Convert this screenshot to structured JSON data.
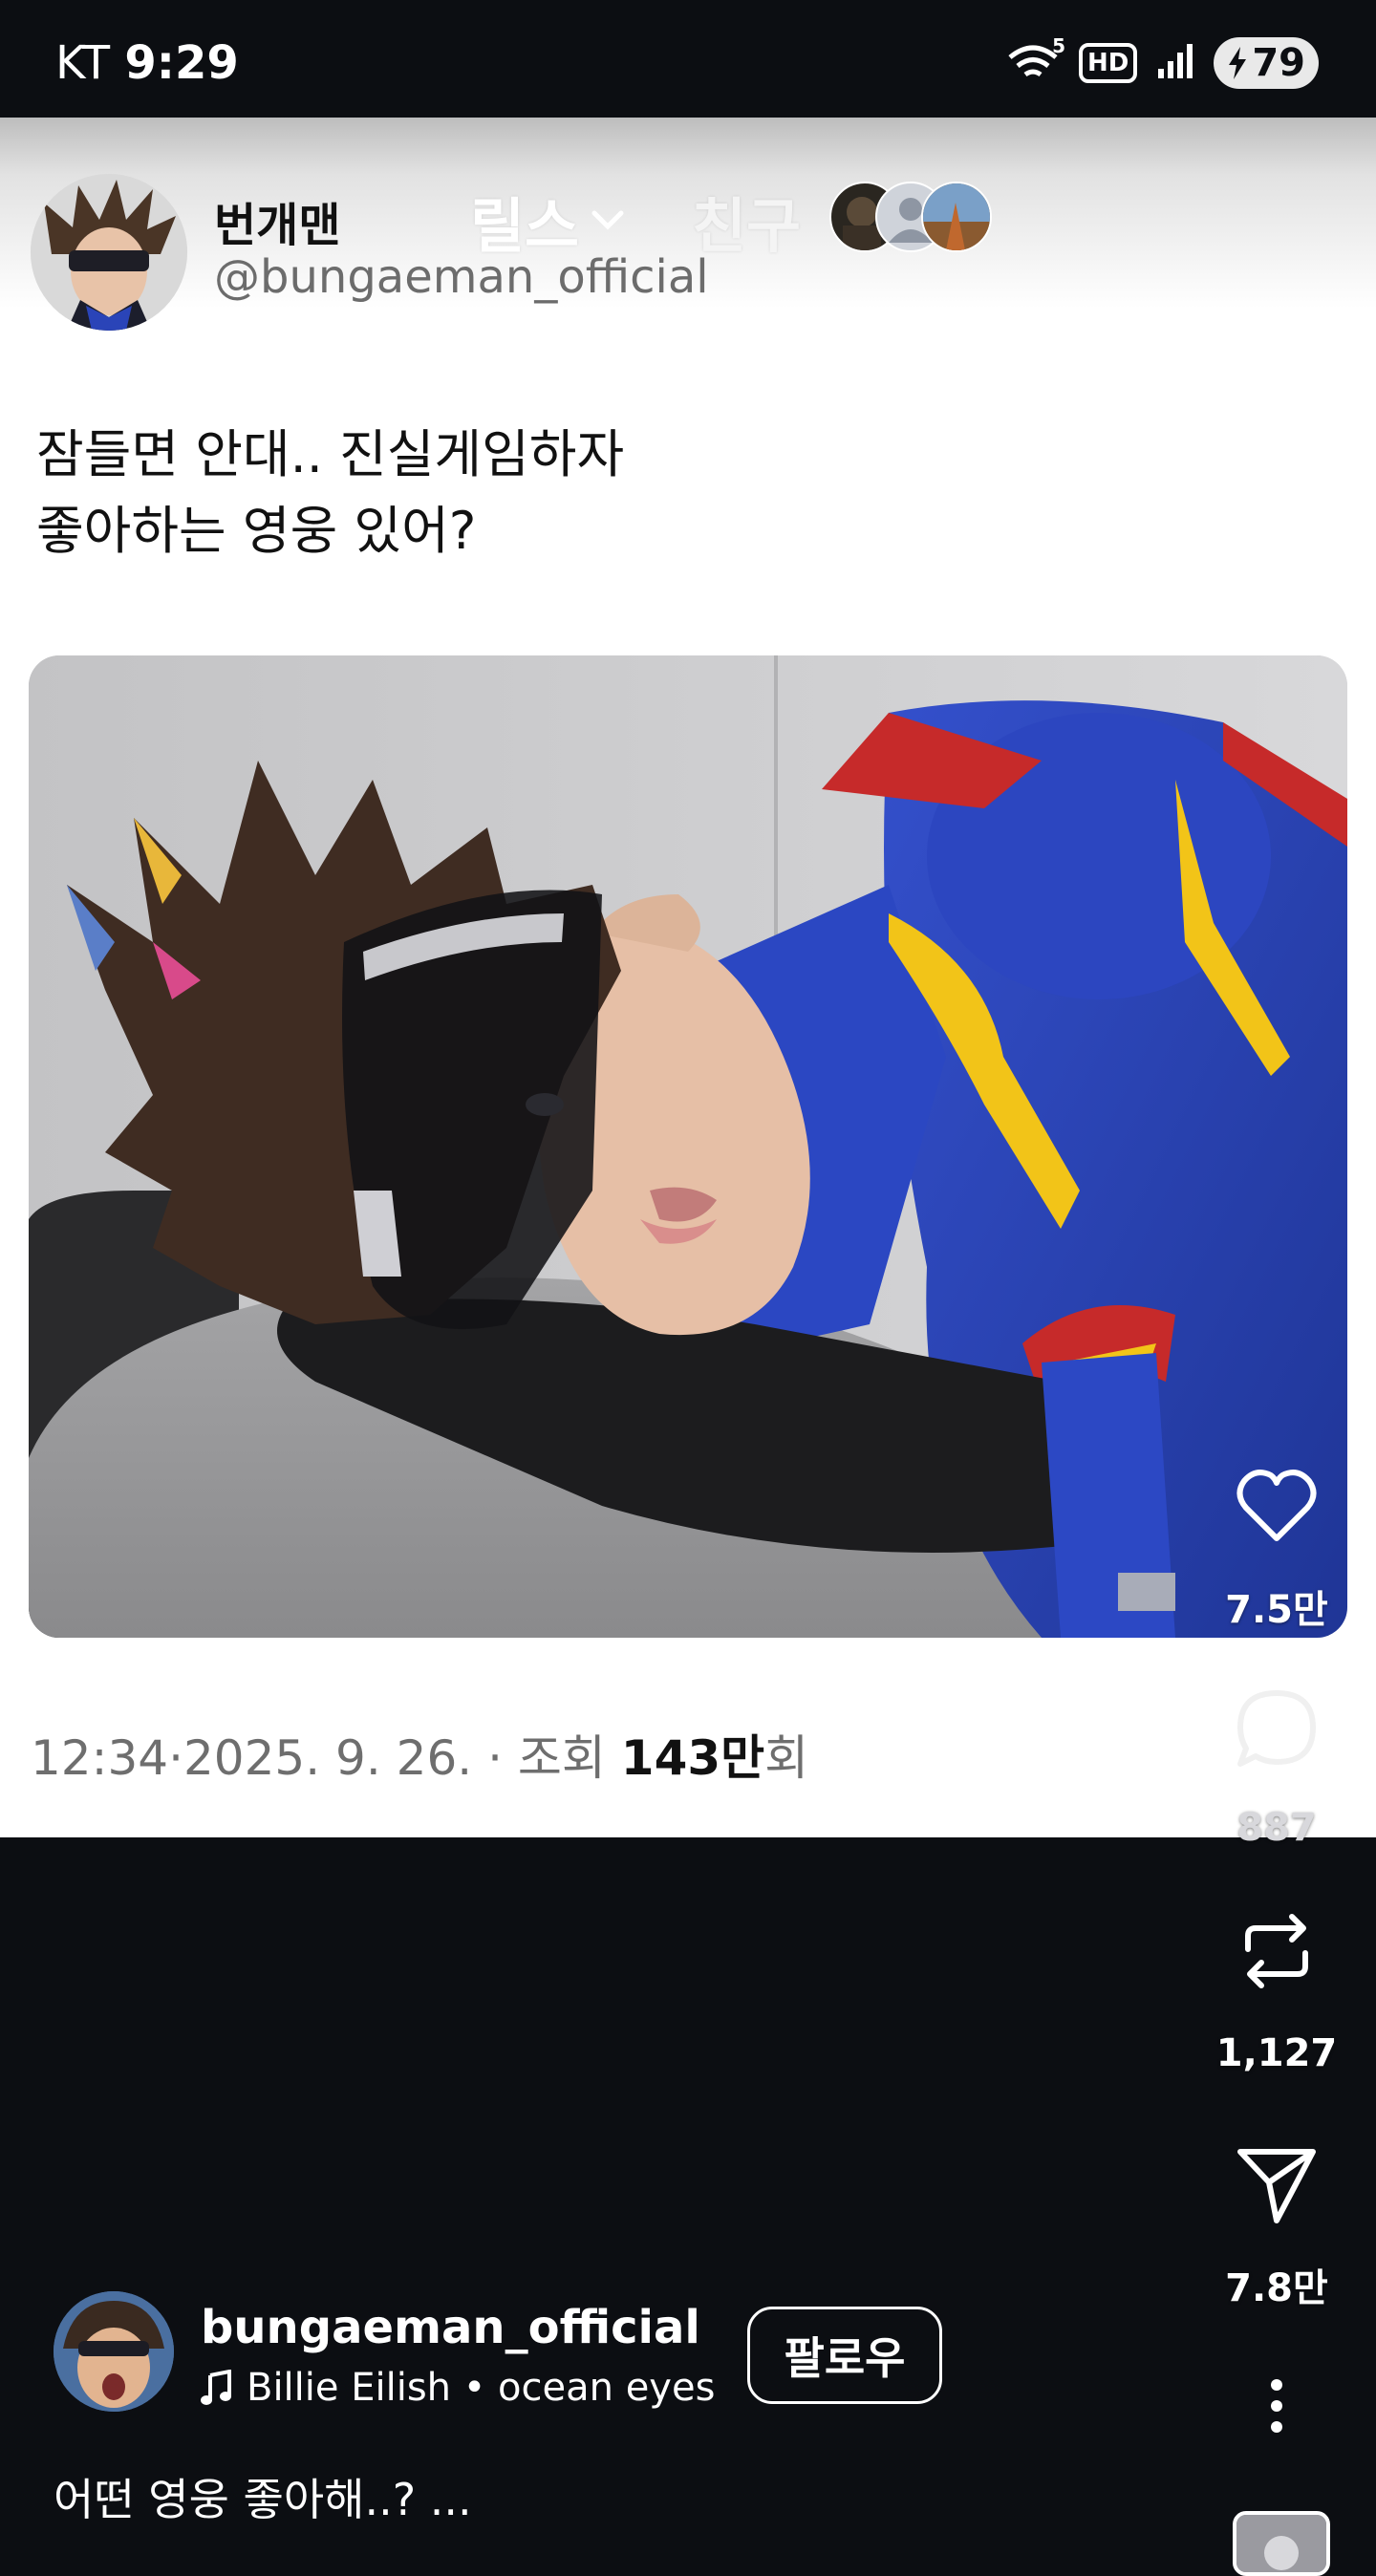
{
  "status_bar": {
    "carrier": "KT",
    "time": "9:29",
    "hd_label": "HD",
    "wifi_label": "5",
    "battery": "79"
  },
  "post": {
    "author_name": "번개맨",
    "author_handle": "@bungaeman_official",
    "caption_line_1": "잠들면 안대.. 진실게임하자",
    "caption_line_2": "좋아하는 영웅 있어?",
    "meta_time": "12:34",
    "meta_sep_1": "·",
    "meta_date": "2025. 9. 26.",
    "meta_sep_2": "·",
    "meta_views_label": "조회",
    "meta_views_value": "143만",
    "meta_views_suffix": "회"
  },
  "top_tabs": {
    "reels": "릴스",
    "friends": "친구"
  },
  "actions": {
    "likes": "7.5만",
    "comments": "887",
    "reposts": "1,127",
    "shares": "7.8만"
  },
  "reel": {
    "username": "bungaeman_official",
    "music": "Billie Eilish • ocean eyes",
    "follow_label": "팔로우",
    "caption": "어떤 영웅 좋아해..? ..."
  },
  "colors": {
    "background": "#0c0e12",
    "card": "#ffffff",
    "suit_blue": "#2a44b8",
    "bolt_yellow": "#f2c418"
  }
}
